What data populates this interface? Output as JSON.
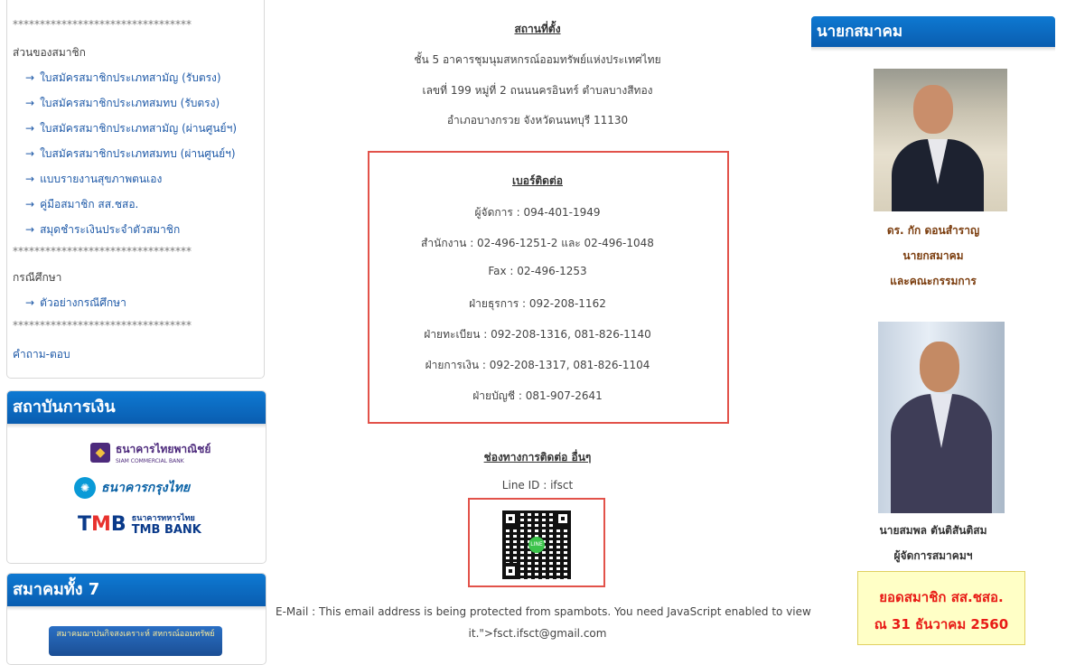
{
  "left": {
    "stars": "*********************************",
    "member_section_title": "ส่วนของสมาชิก",
    "member_links": [
      "ใบสมัครสมาชิกประเภทสามัญ (รับตรง)",
      "ใบสมัครสมาชิกประเภทสมทบ (รับตรง)",
      "ใบสมัครสมาชิกประเภทสามัญ (ผ่านศูนย์ฯ)",
      "ใบสมัครสมาชิกประเภทสมทบ (ผ่านศูนย์ฯ)",
      "แบบรายงานสุขภาพตนเอง",
      "คู่มือสมาชิก สส.ชสอ.",
      "สมุดชำระเงินประจำตัวสมาชิก"
    ],
    "arrow": "→",
    "case_title": "กรณีศึกษา",
    "case_link": "ตัวอย่างกรณีศึกษา",
    "faq": "คำถาม-ตอบ",
    "finance_title": "สถาบันการเงิน",
    "banks": {
      "scb": "ธนาคารไทยพาณิชย์",
      "scb_en": "SIAM COMMERCIAL BANK",
      "ktb": "ธนาคารกรุงไทย",
      "tmb_th": "ธนาคารทหารไทย",
      "tmb_en": "TMB BANK",
      "tmb_mark": "TMB"
    },
    "assoc_title": "สมาคมทั้ง 7",
    "assoc_banner": "สมาคมฌาปนกิจสงเคราะห์ สหกรณ์ออมทรัพย์"
  },
  "center": {
    "location_heading": "สถานที่ตั้ง",
    "address": [
      "ชั้น 5 อาคารชุมนุมสหกรณ์ออมทรัพย์แห่งประเทศไทย",
      "เลขที่ 199 หมู่ที่ 2 ถนนนครอินทร์ ตำบลบางสีทอง",
      "อำเภอบางกรวย จังหวัดนนทบุรี 11130"
    ],
    "contact_heading": "เบอร์ติดต่อ",
    "contacts": [
      "ผู้จัดการ : 094-401-1949",
      "สำนักงาน : 02-496-1251-2 และ 02-496-1048",
      "Fax : 02-496-1253",
      "ฝ่ายธุรการ : 092-208-1162",
      "ฝ่ายทะเบียน : 092-208-1316, 081-826-1140",
      "ฝ่ายการเงิน : 092-208-1317, 081-826-1104",
      "ฝ่ายบัญชี : 081-907-2641"
    ],
    "other_heading": "ช่องทางการติดต่อ อื่นๆ",
    "line_id": "Line ID : ifsct",
    "qr_badge": "LINE",
    "email_line1": "E-Mail : This email address is being protected from spambots. You need JavaScript enabled to view",
    "email_line2": "it.\">fsct.ifsct@gmail.com"
  },
  "right": {
    "title": "นายกสมาคม",
    "president_name": "ดร. กัก ดอนสำราญ",
    "president_role1": "นายกสมาคม",
    "president_role2": "และคณะกรรมการ",
    "manager_name": "นายสมพล ตันติสันติสม",
    "manager_role": "ผู้จัดการสมาคมฯ",
    "member_box_line1": "ยอดสมาชิก สส.ชสอ.",
    "member_box_line2": "ณ 31 ธันวาคม 2560"
  },
  "colors": {
    "header_blue": "#0a6cc6",
    "link_blue": "#1f5aa8",
    "highlight_red": "#e2524a",
    "brown_text": "#7b3d0e",
    "member_red": "#e81b16"
  }
}
